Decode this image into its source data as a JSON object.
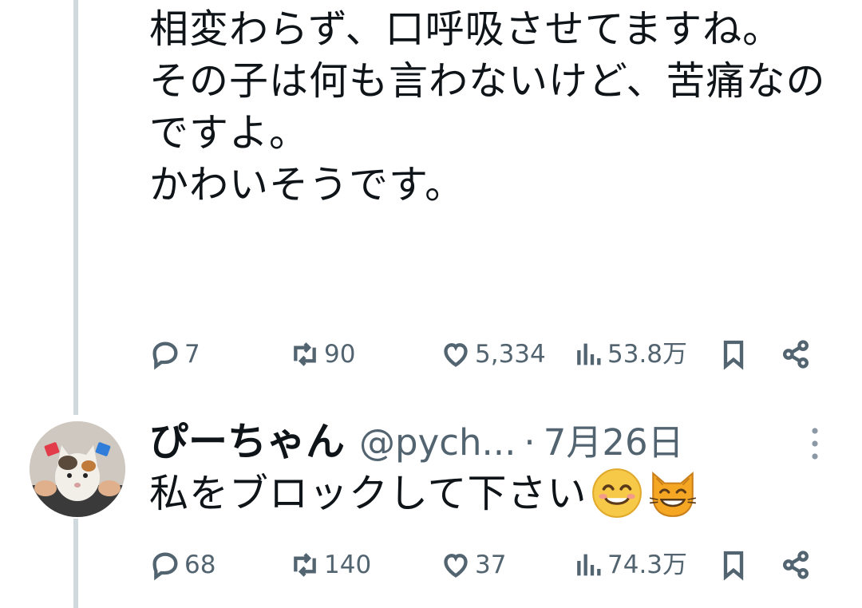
{
  "tweet": {
    "text": "相変わらず、口呼吸させてますね。\nその子は何も言わないけど、苦痛なのですよ。\nかわいそうです。",
    "stats": {
      "replies": "7",
      "retweets": "90",
      "likes": "5,334",
      "views": "53.8万"
    }
  },
  "reply": {
    "display_name": "ぴーちゃん",
    "handle": "@pych...",
    "separator": "·",
    "date": "7月26日",
    "text": "私をブロックして下さい",
    "emojis": [
      "smiling-face-emoji",
      "grinning-cat-emoji"
    ],
    "stats": {
      "replies": "68",
      "retweets": "140",
      "likes": "37",
      "views": "74.3万"
    }
  },
  "icons": {
    "reply": "reply-icon",
    "retweet": "retweet-icon",
    "like": "heart-icon",
    "views": "views-icon",
    "bookmark": "bookmark-icon",
    "share": "share-icon",
    "more": "more-vertical-icon"
  },
  "colors": {
    "text": "#0f1419",
    "muted": "#536471",
    "thread_line": "#cfd9de",
    "emoji_yellow": "#f7c948",
    "cat_orange": "#f5a623"
  }
}
